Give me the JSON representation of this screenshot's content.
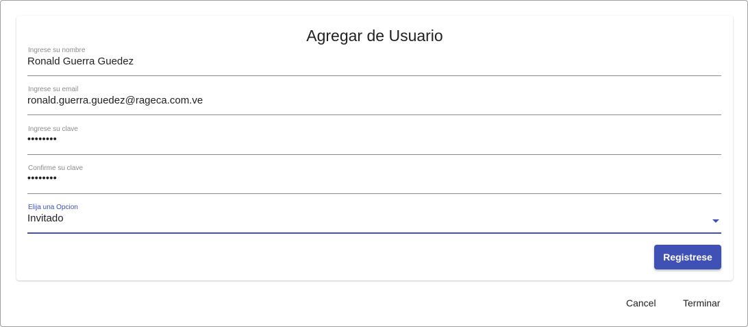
{
  "dialog": {
    "title": "Agregar de Usuario",
    "fields": [
      {
        "label": "Ingrese su nombre",
        "value": "Ronald Guerra Guedez"
      },
      {
        "label": "Ingrese su email",
        "value": "ronald.guerra.guedez@rageca.com.ve"
      },
      {
        "label": "Ingrese su clave",
        "value": "••••••••"
      },
      {
        "label": "Confirme su clave",
        "value": "••••••••"
      }
    ],
    "select": {
      "label": "Elija una Opcion",
      "value": "Invitado"
    },
    "register_label": "Registrese"
  },
  "actions": {
    "cancel_label": "Cancel",
    "finish_label": "Terminar"
  },
  "colors": {
    "accent": "#3f51b5"
  },
  "icons": {
    "select_caret": "chevron-down-icon"
  }
}
